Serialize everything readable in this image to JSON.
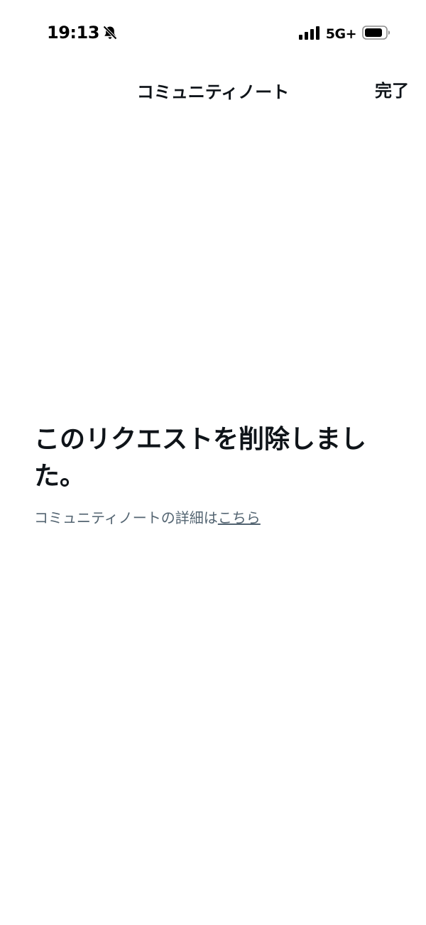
{
  "status_bar": {
    "time": "19:13",
    "network": "5G+",
    "icons": [
      "bell-slash-icon",
      "cellular-signal-icon",
      "battery-icon"
    ]
  },
  "nav": {
    "title": "コミュニティノート",
    "done_label": "完了"
  },
  "message": {
    "title": "このリクエストを削除しました。",
    "subtitle_prefix": "コミュニティノートの詳細は",
    "link_text": "こちら"
  },
  "colors": {
    "text_primary": "#0f1419",
    "text_secondary": "#536471",
    "background": "#ffffff"
  }
}
